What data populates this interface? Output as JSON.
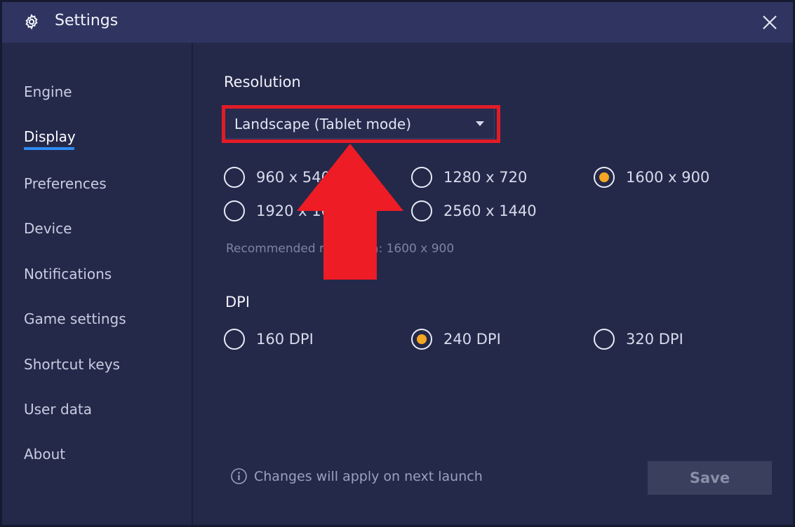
{
  "window": {
    "title": "Settings"
  },
  "sidebar": {
    "items": [
      {
        "label": "Engine",
        "active": false
      },
      {
        "label": "Display",
        "active": true
      },
      {
        "label": "Preferences",
        "active": false
      },
      {
        "label": "Device",
        "active": false
      },
      {
        "label": "Notifications",
        "active": false
      },
      {
        "label": "Game settings",
        "active": false
      },
      {
        "label": "Shortcut keys",
        "active": false
      },
      {
        "label": "User data",
        "active": false
      },
      {
        "label": "About",
        "active": false
      }
    ]
  },
  "resolution": {
    "title": "Resolution",
    "orientation_value": "Landscape (Tablet mode)",
    "options": [
      {
        "label": "960 x 540",
        "checked": false
      },
      {
        "label": "1280 x 720",
        "checked": false
      },
      {
        "label": "1600 x 900",
        "checked": true
      },
      {
        "label": "1920 x 1080",
        "checked": false
      },
      {
        "label": "2560 x 1440",
        "checked": false
      }
    ],
    "recommended": "Recommended resolution: 1600 x 900"
  },
  "dpi": {
    "title": "DPI",
    "options": [
      {
        "label": "160 DPI",
        "checked": false
      },
      {
        "label": "240 DPI",
        "checked": true
      },
      {
        "label": "320 DPI",
        "checked": false
      }
    ]
  },
  "footer": {
    "note": "Changes will apply on next launch",
    "save_label": "Save"
  },
  "colors": {
    "accent_underline": "#2f8df5",
    "radio_selected": "#f5a623",
    "annotation_red": "#e11c27"
  },
  "icons": {
    "title": "gear-icon",
    "close": "close-icon",
    "dropdown": "caret-down-icon",
    "info": "info-icon",
    "annotation": "arrow-up-icon"
  }
}
